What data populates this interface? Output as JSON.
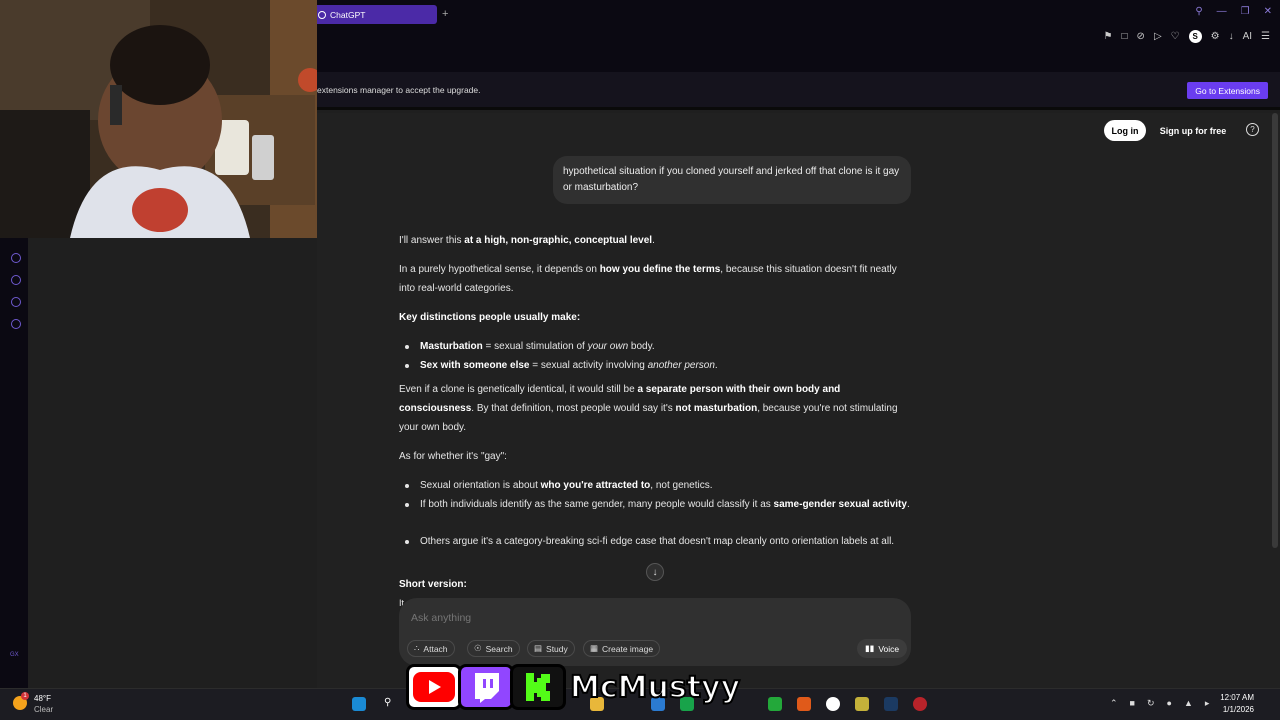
{
  "browser": {
    "tab_title": "ChatGPT",
    "new_tab": "+",
    "ai_label": "AI"
  },
  "notice": {
    "text": "extensions manager to accept the upgrade.",
    "button": "Go to Extensions"
  },
  "header": {
    "login": "Log in",
    "signup": "Sign up for free",
    "help": "?"
  },
  "user_message": "hypothetical situation if you cloned yourself and jerked off that clone is it gay or masturbation?",
  "response": {
    "p1_a": "I'll answer this ",
    "p1_b": "at a high, non-graphic, conceptual level",
    "p1_c": ".",
    "p2_a": "In a purely hypothetical sense, it depends on ",
    "p2_b": "how you define the terms",
    "p2_c": ", because this situation doesn't fit neatly into real-world categories.",
    "heading1": "Key distinctions people usually make:",
    "li1_a": "Masturbation",
    "li1_b": " = sexual stimulation of ",
    "li1_c": "your own",
    "li1_d": " body.",
    "li2_a": "Sex with someone else",
    "li2_b": " = sexual activity involving ",
    "li2_c": "another person",
    "li2_d": ".",
    "p3_a": "Even if a clone is genetically identical, it would still be ",
    "p3_b": "a separate person with their own body and consciousness",
    "p3_c": ". By that definition, most people would say it's ",
    "p3_d": "not masturbation",
    "p3_e": ", because you're not stimulating your own body.",
    "p4": "As for whether it's \"gay\":",
    "li3_a": "Sexual orientation is about ",
    "li3_b": "who you're attracted to",
    "li3_c": ", not genetics.",
    "li4_a": "If both individuals identify as the same gender, many people would classify it as ",
    "li4_b": "same-gender sexual activity",
    "li4_c": ".",
    "li5": "Others argue it's a category-breaking sci-fi edge case that doesn't map cleanly onto orientation labels at all.",
    "heading2": "Short version:",
    "partial": "It"
  },
  "composer": {
    "placeholder": "Ask anything",
    "attach": "Attach",
    "search": "Search",
    "study": "Study",
    "create_image": "Create image",
    "voice": "Voice"
  },
  "taskbar": {
    "temp": "48°F",
    "condition": "Clear",
    "time": "12:07 AM",
    "date": "1/1/2026",
    "weather_badge": "1"
  },
  "stream_overlay": {
    "handle": "McMustyy",
    "youtube_color": "#ff0000",
    "twitch_color": "#9146ff",
    "kick_color": "#53fc18"
  },
  "sidebar": {
    "gx_label": "GX"
  }
}
